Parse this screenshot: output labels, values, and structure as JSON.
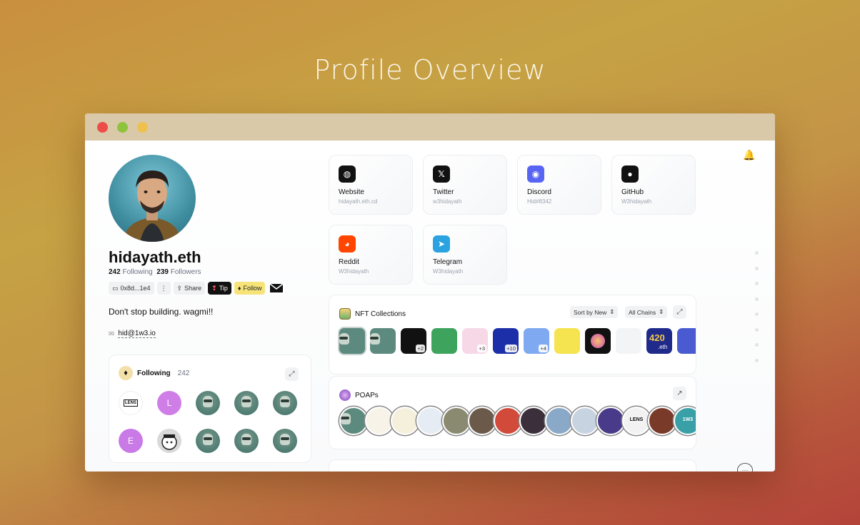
{
  "page": {
    "heading": "Profile Overview"
  },
  "profile": {
    "username": "hidayath.eth",
    "following_count": "242",
    "following_label": "Following",
    "followers_count": "239",
    "followers_label": "Followers",
    "address": "0x8d...1e4",
    "more_label": "⋮",
    "share_label": "Share",
    "tip_label": "Tip",
    "follow_label": "Follow",
    "bio": "Don't stop building. wagmi!!",
    "email": "hid@1w3.io"
  },
  "following": {
    "title": "Following",
    "count": "242",
    "avatars": [
      {
        "kind": "logo",
        "text": "LENS"
      },
      {
        "kind": "letter",
        "text": "L",
        "color": "#cf7ee8"
      },
      {
        "kind": "frog"
      },
      {
        "kind": "frog"
      },
      {
        "kind": "frog"
      },
      {
        "kind": "letter",
        "text": "E",
        "color": "#c97ae6"
      },
      {
        "kind": "ghost"
      },
      {
        "kind": "frog"
      },
      {
        "kind": "frog"
      },
      {
        "kind": "frog"
      }
    ]
  },
  "socials": [
    {
      "name": "Website",
      "handle": "hidayath.eth.cd",
      "icon": "globe-icon",
      "color": "#111111"
    },
    {
      "name": "Twitter",
      "handle": "w3hidayath",
      "icon": "x-icon",
      "color": "#111111"
    },
    {
      "name": "Discord",
      "handle": "Hid#8342",
      "icon": "discord-icon",
      "color": "#5865f2"
    },
    {
      "name": "GitHub",
      "handle": "W3hidayath",
      "icon": "github-icon",
      "color": "#111111"
    },
    {
      "name": "Reddit",
      "handle": "W3hidayath",
      "icon": "reddit-icon",
      "color": "#ff4500"
    },
    {
      "name": "Telegram",
      "handle": "W3hidayath",
      "icon": "telegram-icon",
      "color": "#2aa3e0"
    }
  ],
  "nft": {
    "title": "NFT Collections",
    "sort_label": "Sort by New",
    "chain_label": "All Chains",
    "items": [
      {
        "bg": "#5d8a7f",
        "badge": ""
      },
      {
        "bg": "#5d8a7f",
        "badge": ""
      },
      {
        "bg": "#111111",
        "badge": "+2"
      },
      {
        "bg": "#3ea35c",
        "badge": ""
      },
      {
        "bg": "#f7d8e6",
        "badge": "+3"
      },
      {
        "bg": "#1c2fa8",
        "badge": "+10"
      },
      {
        "bg": "#7fa9f0",
        "badge": "+4"
      },
      {
        "bg": "#f5e34f",
        "badge": ""
      },
      {
        "bg": "#111111",
        "badge": ""
      },
      {
        "bg": "#f3f4f6",
        "badge": ""
      },
      {
        "bg": "#1f2a8a",
        "badge": ""
      },
      {
        "bg": "#4a5bd1",
        "badge": ""
      }
    ],
    "item_420_text": "420",
    "item_420_sub": ".eth"
  },
  "poaps": {
    "title": "POAPs",
    "items": [
      "#5d8a7f",
      "#f7f3e8",
      "#f4f0dc",
      "#e6ecf3",
      "#8a8a70",
      "#6b5a4a",
      "#d14a3a",
      "#3a2f3a",
      "#8aa8c8",
      "#c7d3e0",
      "#4a3a8a",
      "#f2f2f2",
      "#7a3a2a",
      "#3aa0a8"
    ],
    "last_text": "1W3",
    "lens_text": "LENS"
  },
  "icons": {
    "bell": "bell-icon",
    "chat": "chat-icon",
    "mail": "mail-icon"
  }
}
